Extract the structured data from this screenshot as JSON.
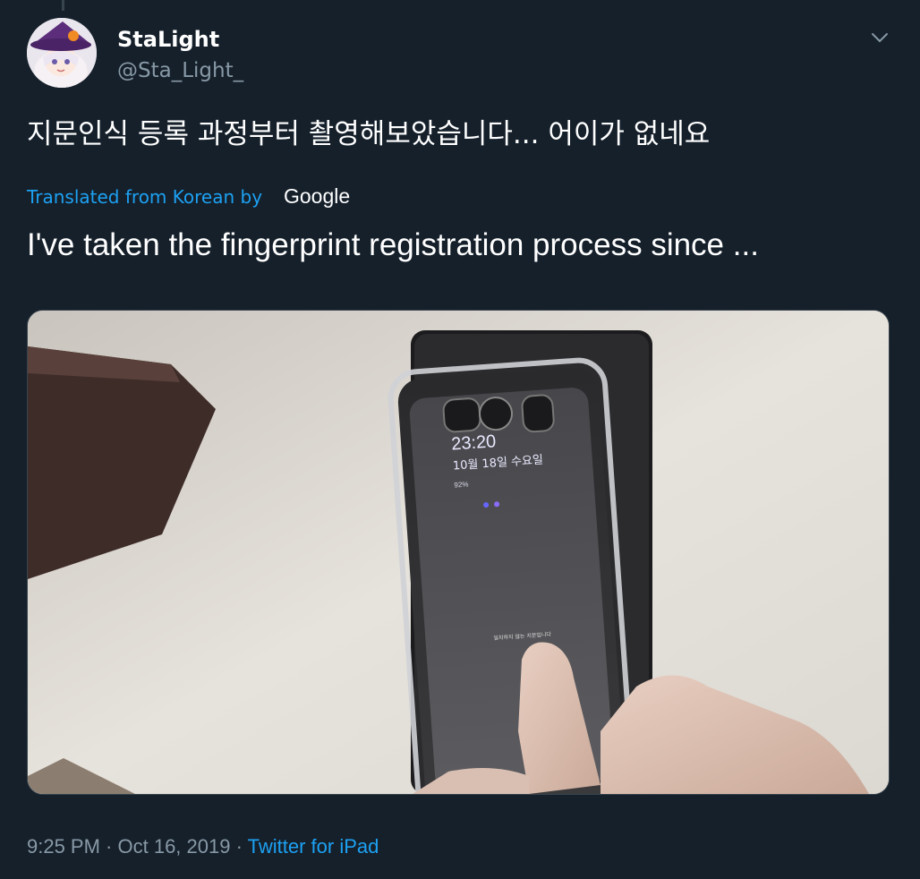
{
  "tweet": {
    "author": {
      "name": "StaLight",
      "handle": "@Sta_Light_"
    },
    "text": "지문인식 등록 과정부터 촬영해보았습니다... 어이가 없네요",
    "translation": {
      "label": "Translated from Korean by",
      "provider": "Google",
      "text": "I've taken the fingerprint registration process since ..."
    },
    "media": {
      "phone_screen": {
        "time": "23:20",
        "date": "10월 18일 수요일",
        "battery": "92%",
        "fingerprint_prompt": "일치하지 않는 지문입니다"
      }
    },
    "meta": {
      "time": "9:25 PM",
      "separator1": " · ",
      "date": "Oct 16, 2019",
      "separator2": " · ",
      "source": "Twitter for iPad"
    }
  },
  "icons": {
    "caret": "chevron-down-icon"
  },
  "colors": {
    "background": "#15202b",
    "link": "#1da1f2",
    "secondary_text": "#8899a6",
    "border": "#38444d"
  }
}
